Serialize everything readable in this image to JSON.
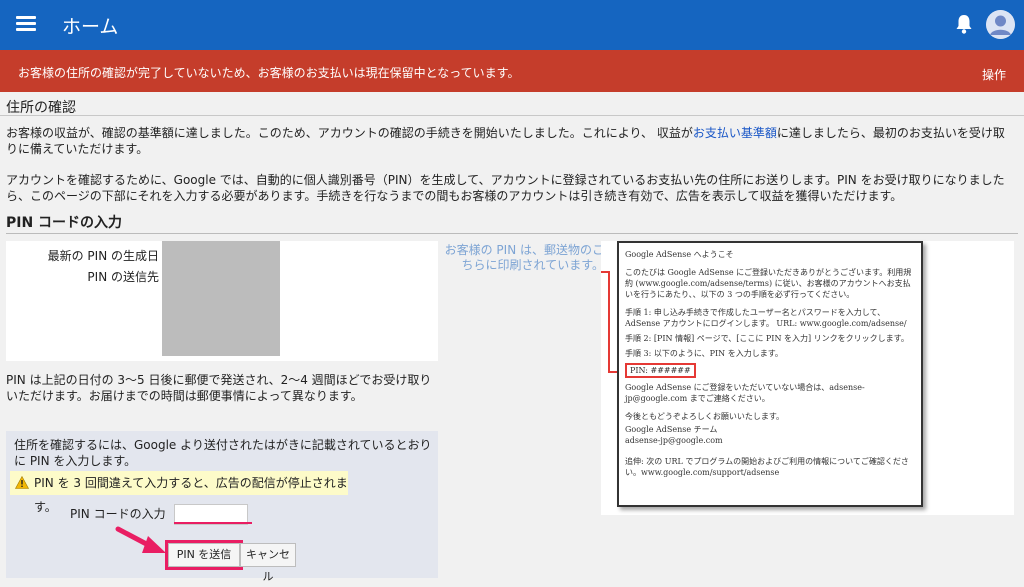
{
  "appbar": {
    "title": "ホーム"
  },
  "alert": {
    "message": "お客様の住所の確認が完了していないため、お客様のお支払いは現在保留中となっています。",
    "action": "操作"
  },
  "address": {
    "title": "住所の確認",
    "para1_a": "お客様の収益が、確認の基準額に達しました。このため、アカウントの確認の手続きを開始いたしました。これにより、 収益が",
    "para1_link": "お支払い基準額",
    "para1_b": "に達しましたら、最初のお支払いを受け取りに備えていただけます。",
    "para2": "アカウントを確認するために、Google では、自動的に個人識別番号（PIN）を生成して、アカウントに登録されているお支払い先の住所にお送りします。PIN をお受け取りになりましたら、このページの下部にそれを入力する必要があります。手続きを行なうまでの間もお客様のアカウントは引き続き有効で、広告を表示して収益を獲得いただけます。"
  },
  "pin": {
    "heading": "PIN コードの入力",
    "generated_label": "最新の PIN の生成日",
    "sent_to_label": "PIN の送信先",
    "note": "PIN は上記の日付の 3～5 日後に郵便で発送され、2～4 週間ほどでお受け取りいただけます。お届けまでの時間は郵便事情によって異なります。",
    "form_instructions": "住所を確認するには、Google より送付されたはがきに記載されているとおりに PIN を入力します。",
    "warning": "PIN を 3 回間違えて入力すると、広告の配信が停止されます。",
    "input_label": "PIN コードの入力",
    "input_value": "",
    "submit_label": "PIN を送信",
    "cancel_label": "キャンセル"
  },
  "annotation": "お客様の PIN は、郵送物のこちらに印刷されています。",
  "letter": {
    "heading": "Google AdSense へようこそ",
    "intro": "このたびは Google AdSense にご登録いただきありがとうございます。利用規約 (www.google.com/adsense/terms) に従い、お客様のアカウントへお支払いを行うにあたり、、以下の 3 つの手順を必ず行ってください。",
    "step1": "手順 1: 申し込み手続きで作成したユーザー名とパスワードを入力して、AdSense アカウントにログインします。 URL: www.google.com/adsense/",
    "step2": "手順 2: [PIN 情報] ページで、[ここに PIN を入力] リンクをクリックします。",
    "step3": "手順 3: 以下のように、PIN を入力します。",
    "pin_line": "PIN: ######",
    "contact": "Google AdSense にご登録をいただいていない場合は、adsense-jp@google.com までご連絡ください。",
    "closing": "今後ともどうぞよろしくお願いいたします。",
    "team": "Google AdSense チーム",
    "email": "adsense-jp@google.com",
    "ps": "追伸: 次の URL でプログラムの開始およびご利用の情報についてご確認ください。www.google.com/support/adsense"
  },
  "colors": {
    "appbar": "#1565c0",
    "alert": "#c53d2b",
    "highlight": "#e91e63"
  }
}
